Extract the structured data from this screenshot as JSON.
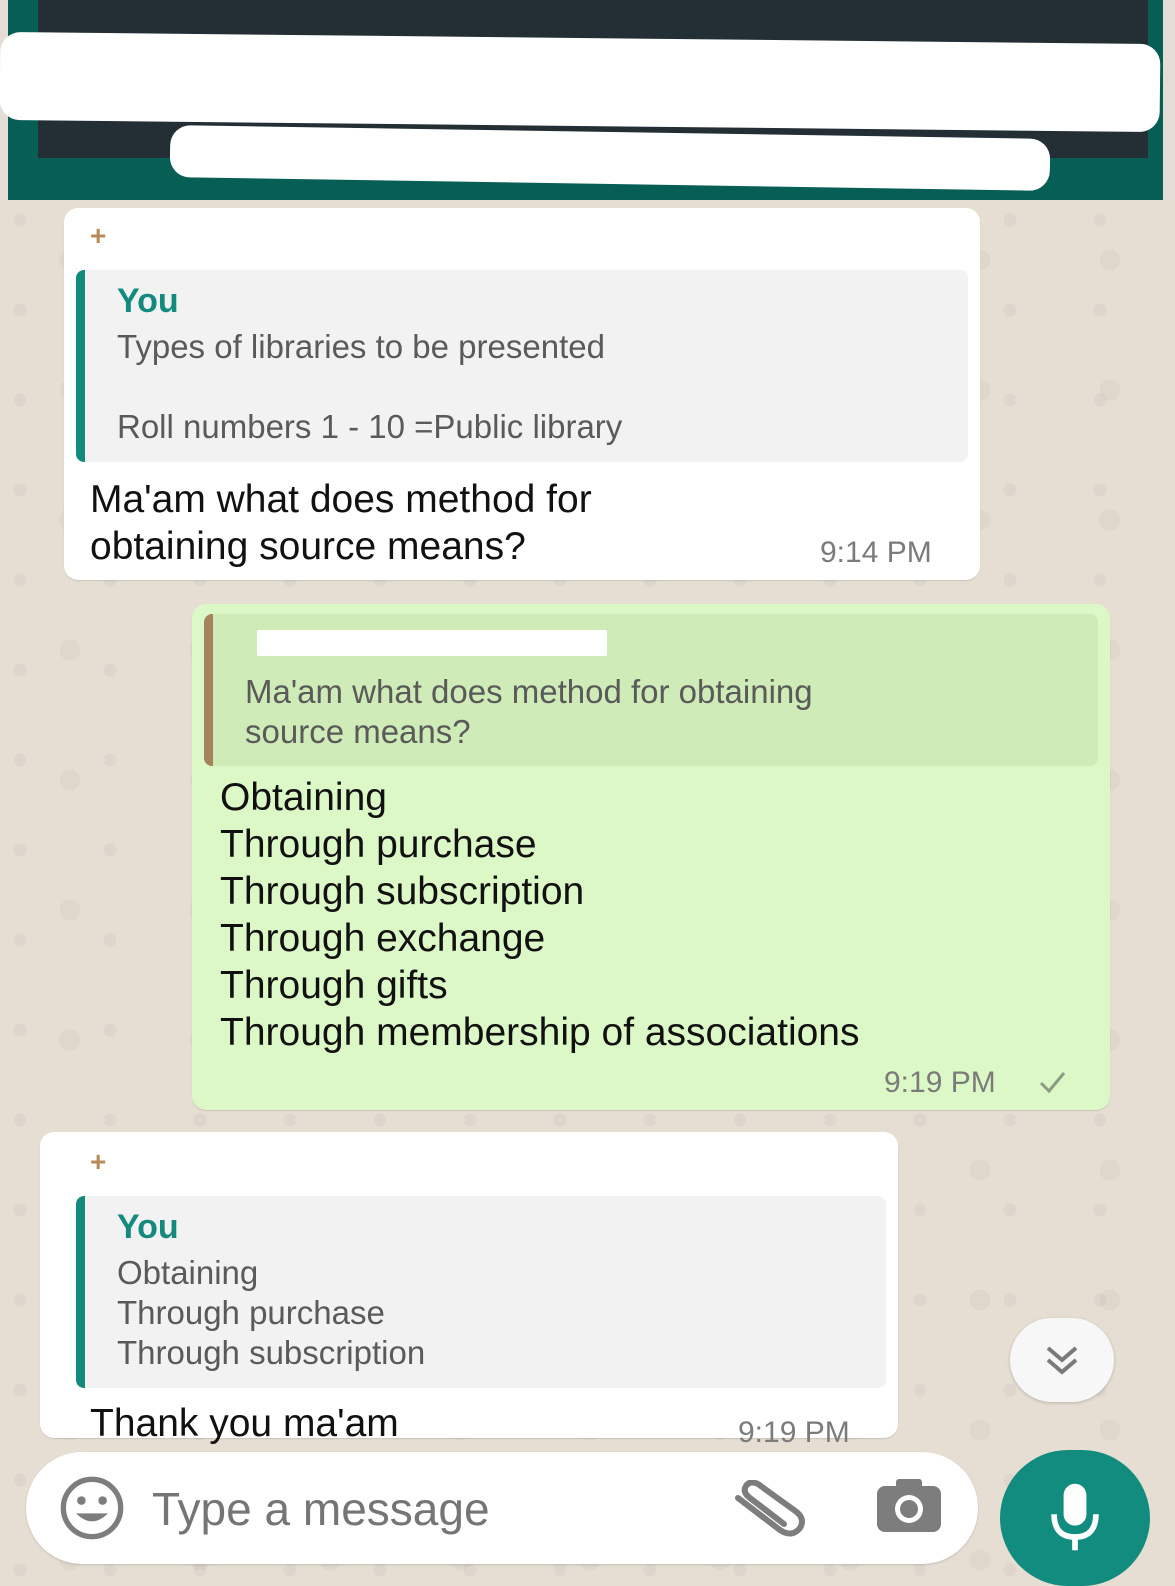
{
  "messages": {
    "first": {
      "quote_author": "You",
      "quote_line1": "Types of libraries to be presented",
      "quote_line2": "Roll numbers 1  - 10 =Public library",
      "text_line1": "Ma'am what does method for",
      "text_line2": "obtaining source means?",
      "time": "9:14 PM"
    },
    "second": {
      "quote_line1": "Ma'am what does method for obtaining",
      "quote_line2": "source means?",
      "lines": [
        "Obtaining",
        "Through purchase",
        "Through subscription",
        "Through exchange",
        "Through gifts",
        "Through membership of associations"
      ],
      "time": "9:19 PM"
    },
    "third": {
      "quote_author": "You",
      "quote_lines": [
        "Obtaining",
        "Through purchase",
        "Through subscription"
      ],
      "text": "Thank you ma'am",
      "time": "9:19 PM"
    }
  },
  "input": {
    "placeholder": "Type a message"
  },
  "icons": {
    "emoji": "emoji-icon",
    "attach": "paperclip-icon",
    "camera": "camera-icon",
    "mic": "mic-icon",
    "scroll": "chevron-double-down-icon",
    "read": "check-icon"
  },
  "colors": {
    "header": "#075e54",
    "outgoing": "#dcf8c6",
    "incoming": "#ffffff",
    "accent": "#128c7e"
  }
}
